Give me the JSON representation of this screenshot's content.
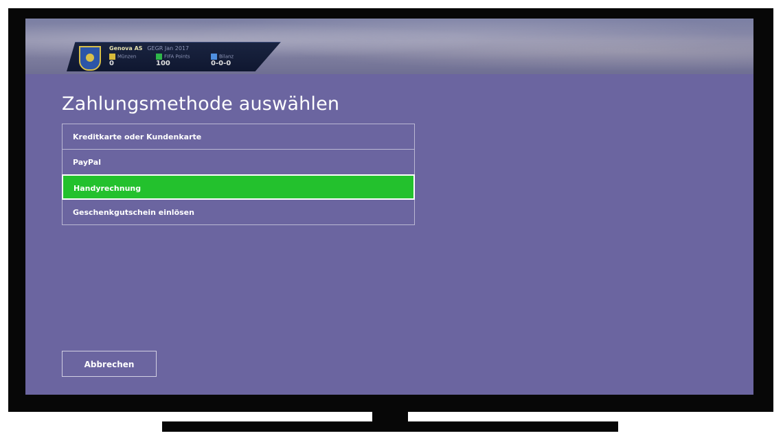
{
  "hud": {
    "team": "Genova AS",
    "team_sub": "GEGR Jan 2017",
    "stats": [
      {
        "label": "Münzen",
        "value": "0",
        "color": "#d7b93a"
      },
      {
        "label": "FIFA Points",
        "value": "100",
        "color": "#2fb64a"
      },
      {
        "label": "Bilanz",
        "value": "0-0-0",
        "color": "#4f8fe0"
      }
    ]
  },
  "page": {
    "title": "Zahlungsmethode auswählen"
  },
  "methods": [
    {
      "label": "Kreditkarte oder Kundenkarte",
      "selected": false
    },
    {
      "label": "PayPal",
      "selected": false
    },
    {
      "label": "Handyrechnung",
      "selected": true
    },
    {
      "label": "Geschenkgutschein einlösen",
      "selected": false
    }
  ],
  "actions": {
    "cancel_label": "Abbrechen"
  },
  "colors": {
    "background": "#6b65a0",
    "selected": "#23c12d"
  }
}
